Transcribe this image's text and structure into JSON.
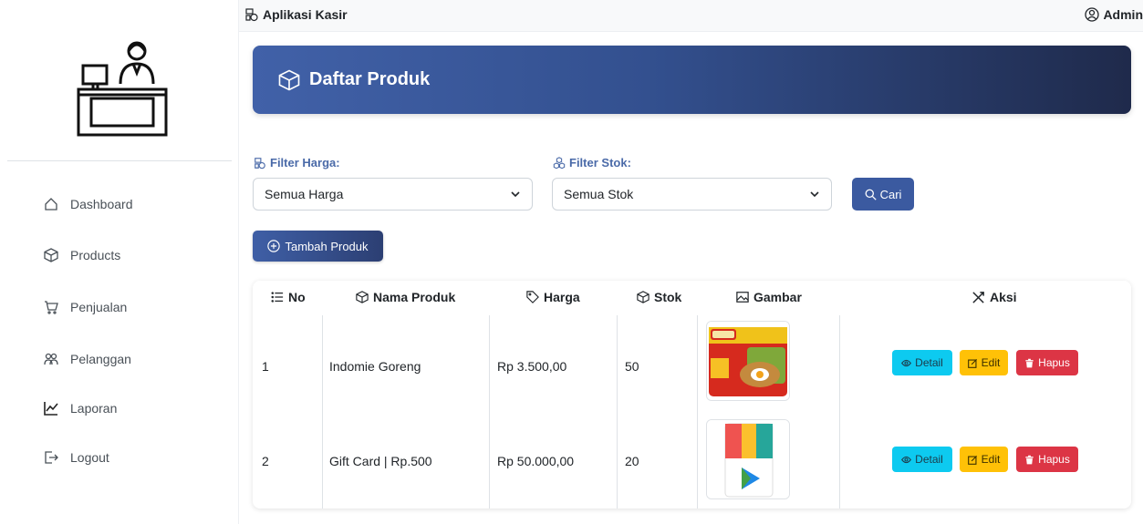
{
  "topbar": {
    "app_title": "Aplikasi Kasir",
    "user": "Admin"
  },
  "sidebar": {
    "items": [
      {
        "label": "Dashboard",
        "icon": "home-icon"
      },
      {
        "label": "Products",
        "icon": "box-icon"
      },
      {
        "label": "Penjualan",
        "icon": "cart-icon"
      },
      {
        "label": "Pelanggan",
        "icon": "people-icon"
      },
      {
        "label": "Laporan",
        "icon": "chart-line-icon"
      },
      {
        "label": "Logout",
        "icon": "logout-icon"
      }
    ]
  },
  "header": {
    "title": "Daftar Produk"
  },
  "filters": {
    "price_label": "Filter Harga:",
    "price_value": "Semua Harga",
    "stock_label": "Filter Stok:",
    "stock_value": "Semua Stok",
    "search_button": "Cari"
  },
  "add_button": "Tambah Produk",
  "table": {
    "headers": {
      "no": "No",
      "name": "Nama Produk",
      "price": "Harga",
      "stock": "Stok",
      "image": "Gambar",
      "action": "Aksi"
    },
    "rows": [
      {
        "no": "1",
        "name": "Indomie Goreng",
        "price": "Rp 3.500,00",
        "stock": "50",
        "image": "indomie-image"
      },
      {
        "no": "2",
        "name": "Gift Card | Rp.500",
        "price": "Rp 50.000,00",
        "stock": "20",
        "image": "google-play-card-image"
      }
    ],
    "actions": {
      "detail": "Detail",
      "edit": "Edit",
      "delete": "Hapus"
    }
  },
  "colors": {
    "primary": "#3b5aa0",
    "header_dark": "#1f2a4b",
    "info": "#0dcaf0",
    "warning": "#ffc107",
    "danger": "#dc3545"
  }
}
